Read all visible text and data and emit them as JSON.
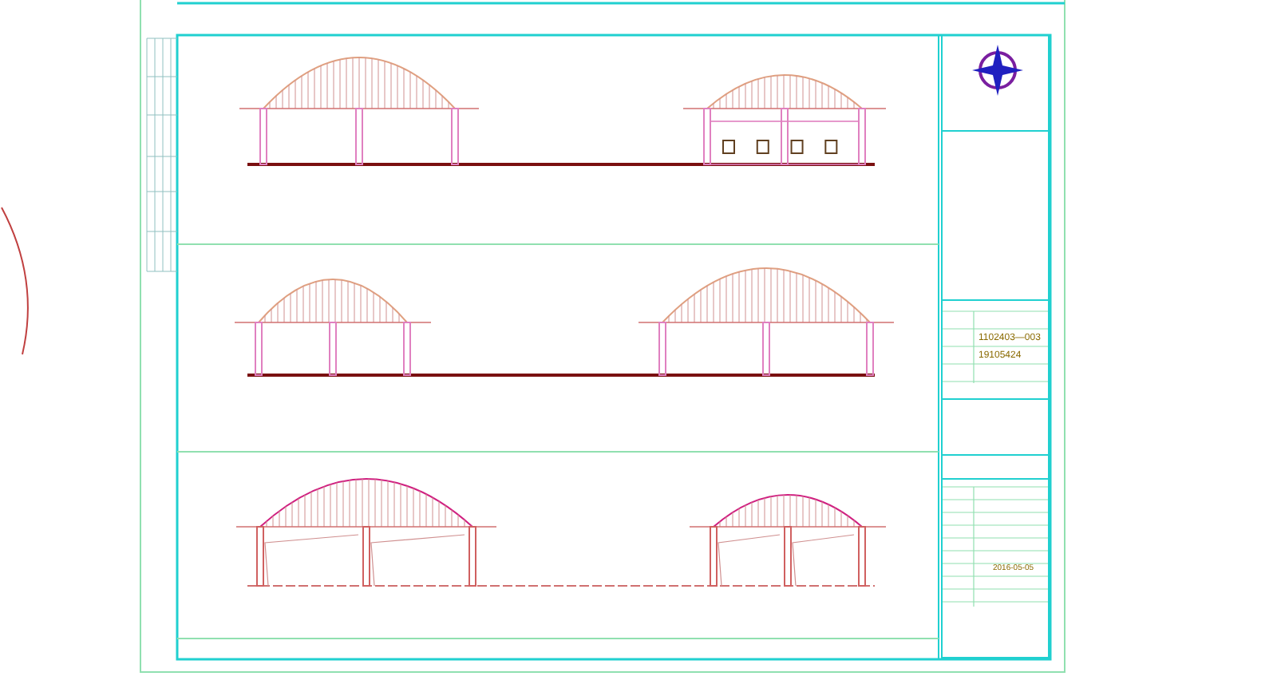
{
  "elevations": [
    {
      "buildings": [
        {
          "kind": "open"
        },
        {
          "kind": "windowed"
        }
      ]
    },
    {
      "buildings": [
        {
          "kind": "open"
        },
        {
          "kind": "open"
        }
      ]
    },
    {
      "buildings": [
        {
          "kind": "section"
        },
        {
          "kind": "section"
        }
      ]
    }
  ],
  "title_block": {
    "project_number": "1102403—003",
    "drawing_number": "19105424",
    "date": "2016-05-05"
  }
}
